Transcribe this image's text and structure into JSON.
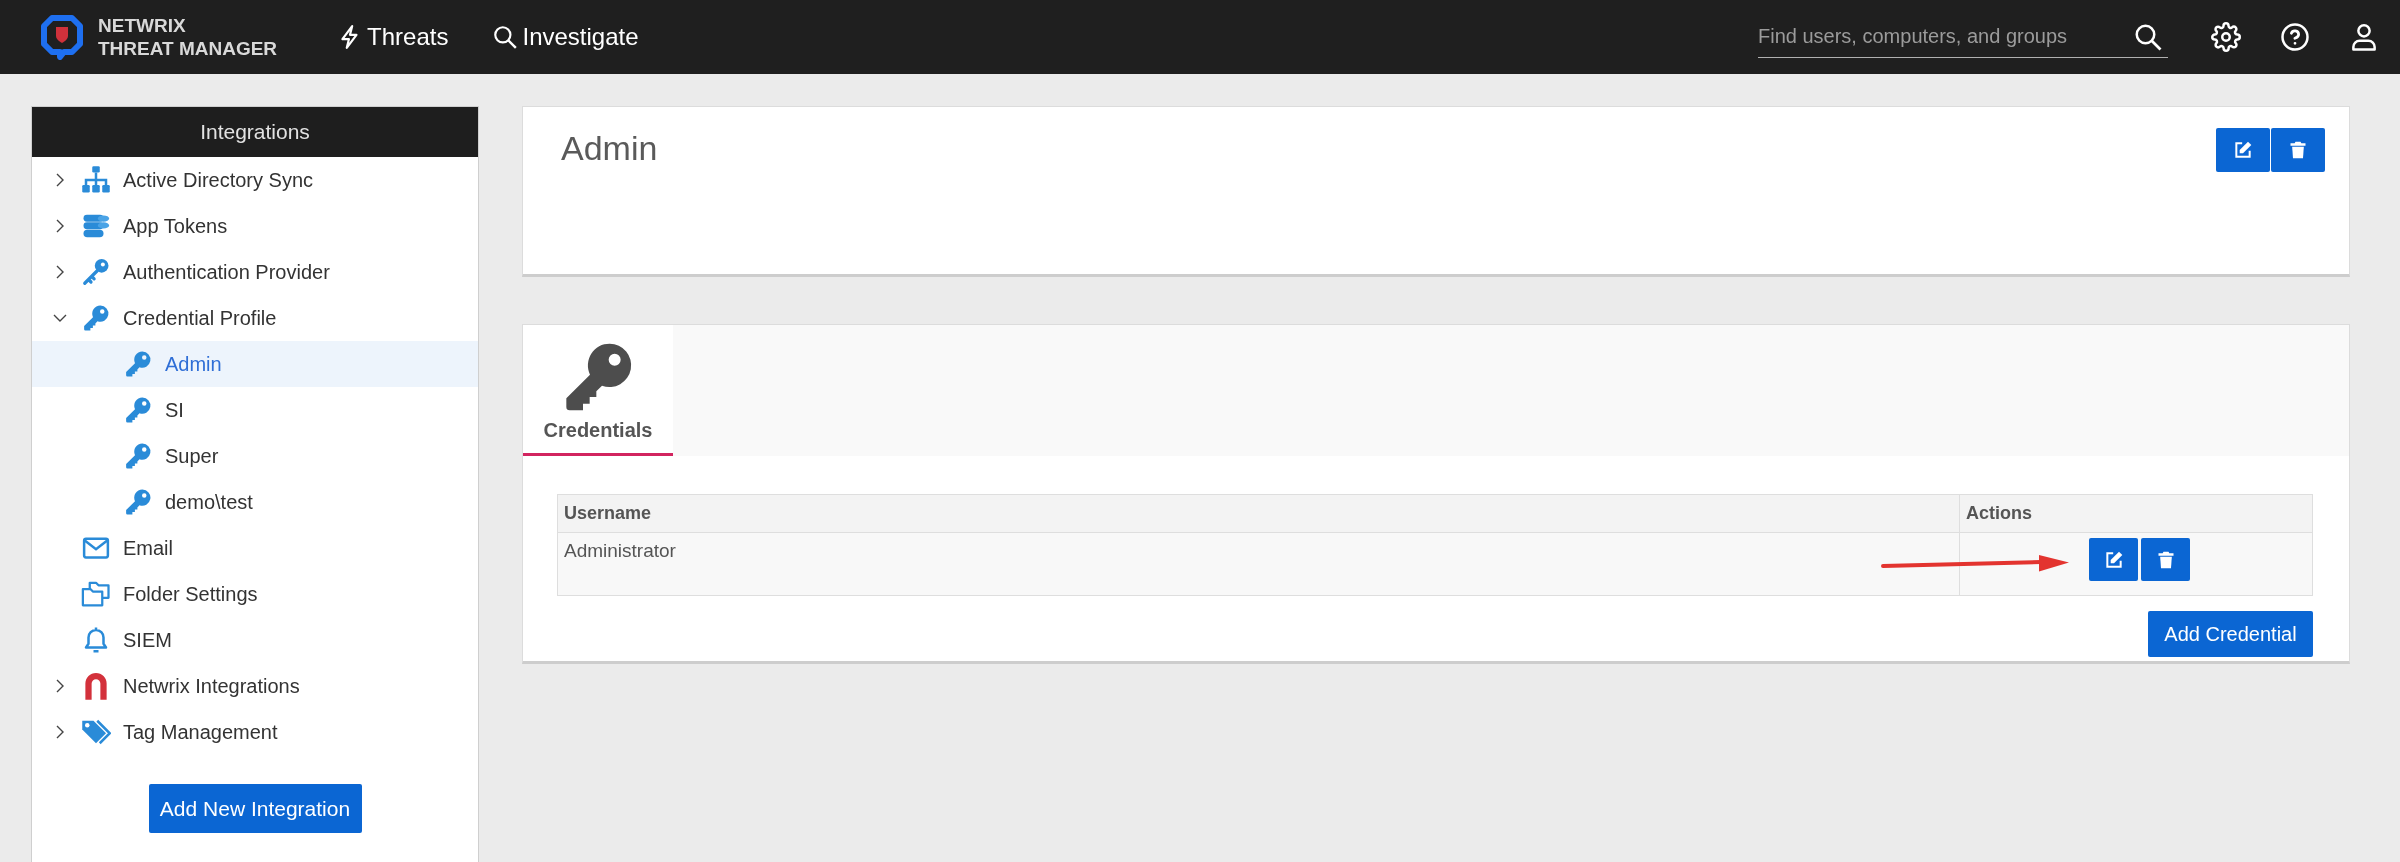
{
  "top_bar": {
    "logo": {
      "line_1": "NETWRIX",
      "line_2": "THREAT MANAGER"
    },
    "nav": [
      {
        "kind": "threats",
        "label": "Threats"
      },
      {
        "kind": "investigate",
        "label": "Investigate"
      }
    ],
    "search": {
      "placeholder": "Find users, computers, and groups"
    }
  },
  "sidebar": {
    "title": "Integrations",
    "items": [
      {
        "kind": "directory",
        "label": "Active Directory Sync",
        "expanded": false,
        "selected": false
      },
      {
        "kind": "tokens",
        "label": "App Tokens",
        "expanded": false,
        "selected": false
      },
      {
        "kind": "provider",
        "label": "Authentication Provider",
        "expanded": false,
        "selected": false
      },
      {
        "kind": "profile",
        "label": "Credential Profile",
        "expanded": true,
        "selected": false,
        "children": [
          {
            "kind": "credential",
            "label": "Admin",
            "selected": true
          },
          {
            "kind": "credential",
            "label": "SI",
            "selected": false
          },
          {
            "kind": "credential",
            "label": "Super",
            "selected": false
          },
          {
            "kind": "credential",
            "label": "demo\\test",
            "selected": false
          }
        ]
      },
      {
        "kind": "email",
        "label": "Email",
        "selected": false
      },
      {
        "kind": "folder",
        "label": "Folder Settings",
        "selected": false
      },
      {
        "kind": "siem",
        "label": "SIEM",
        "selected": false
      },
      {
        "kind": "integrations",
        "label": "Netwrix Integrations",
        "expanded": false,
        "selected": false
      },
      {
        "kind": "tags",
        "label": "Tag Management",
        "expanded": false,
        "selected": false
      }
    ],
    "add_button": "Add New Integration"
  },
  "profile_card": {
    "title": "Admin"
  },
  "credentials_panel": {
    "tabs": [
      {
        "label": "Credentials",
        "selected": true
      }
    ],
    "table": {
      "columns": [
        "Username",
        "Actions"
      ],
      "rows": [
        {
          "username": "Administrator"
        }
      ]
    },
    "add_button": "Add Credential"
  }
}
